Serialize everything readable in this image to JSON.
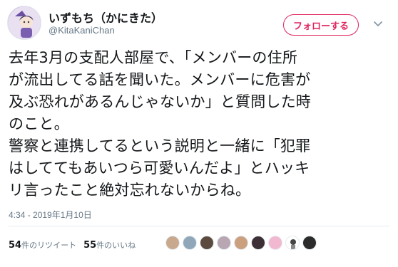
{
  "user": {
    "display_name": "いずもち（かにきた）",
    "handle": "@KitaKaniChan"
  },
  "follow_button": {
    "label": "フォローする"
  },
  "tweet": {
    "lines": [
      "去年3月の支配人部屋で、「メンバーの住所",
      "が流出してる話を聞いた。メンバーに危害が",
      "及ぶ恐れがあるんじゃないか」と質問した時",
      "のこと。",
      "警察と連携してるという説明と一緒に「犯罪",
      "はしててもあいつら可愛いんだよ」とハッキ",
      "リ言ったこと絶対忘れないからね。"
    ],
    "timestamp": "4:34 - 2019年1月10日"
  },
  "stats": {
    "retweets_count": "54",
    "retweets_label": "件のリツイート",
    "likes_count": "55",
    "likes_label": "件のいいね"
  },
  "likers": [
    {
      "icon": "liker-avatar-1",
      "color": "#c9a98e"
    },
    {
      "icon": "liker-avatar-2",
      "color": "#8fa7b8"
    },
    {
      "icon": "liker-avatar-3",
      "color": "#5b4a3d"
    },
    {
      "icon": "liker-avatar-4",
      "color": "#b8a6b2"
    },
    {
      "icon": "liker-avatar-5",
      "color": "#caa07f"
    },
    {
      "icon": "liker-avatar-6",
      "color": "#3c2f35"
    },
    {
      "icon": "liker-avatar-7",
      "color": "#f2b8d0"
    },
    {
      "icon": "liker-avatar-8",
      "color": "#ffffff"
    },
    {
      "icon": "liker-avatar-9",
      "color": "#2b2b2b"
    }
  ],
  "colors": {
    "follow": "#e0245e",
    "muted": "#657786",
    "text": "#14171a"
  }
}
